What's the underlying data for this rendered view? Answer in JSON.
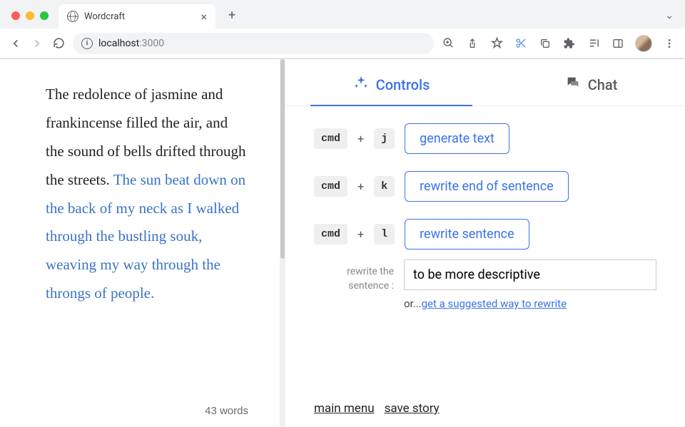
{
  "browser": {
    "tab_title": "Wordcraft",
    "url_host": "localhost",
    "url_port": ":3000"
  },
  "editor": {
    "text_plain": " The redolence of jasmine and frankincense filled the air, and the sound of bells drifted through the streets. ",
    "text_highlight": "The sun beat down on the back of my neck as I walked through the bustling souk, weaving my way through the throngs of people.",
    "word_count_label": "43 words"
  },
  "tabs": {
    "controls_label": "Controls",
    "chat_label": "Chat"
  },
  "controls": {
    "shortcuts": [
      {
        "mod": "cmd",
        "key": "j",
        "action": "generate text"
      },
      {
        "mod": "cmd",
        "key": "k",
        "action": "rewrite end of sentence"
      },
      {
        "mod": "cmd",
        "key": "l",
        "action": "rewrite sentence"
      }
    ],
    "rewrite_label": "rewrite the sentence :",
    "rewrite_value": "to be more descriptive",
    "or_prefix": "or...",
    "or_link": "get a suggested way to rewrite"
  },
  "footer": {
    "main_menu": "main menu",
    "save_story": "save story"
  }
}
